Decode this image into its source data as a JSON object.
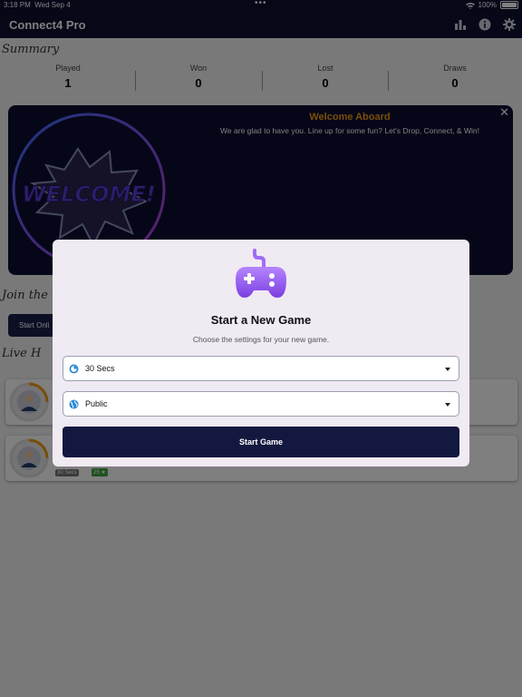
{
  "status_bar": {
    "time": "3:18 PM",
    "date": "Wed Sep 4",
    "dots": "•••",
    "battery": "100%"
  },
  "navbar": {
    "title": "Connect4 Pro",
    "icons": [
      "bar-chart-icon",
      "info-icon",
      "gear-icon"
    ]
  },
  "summary": {
    "title": "Summary",
    "stats": [
      {
        "label": "Played",
        "value": "1"
      },
      {
        "label": "Won",
        "value": "0"
      },
      {
        "label": "Lost",
        "value": "0"
      },
      {
        "label": "Draws",
        "value": "0"
      }
    ]
  },
  "welcome_banner": {
    "title": "Welcome Aboard",
    "subtitle": "We are glad to have you. Line up for some fun? Let's Drop, Connect, & Win!",
    "graphic_text": "WELCOME!",
    "close": "✕"
  },
  "join": {
    "title": "Join the T",
    "button": "Start Onli"
  },
  "live": {
    "title": "Live H",
    "games": [
      {
        "time_tag": "",
        "points_tag": ""
      },
      {
        "time_tag": "30 Secs",
        "points_tag": "25 ★"
      }
    ]
  },
  "modal": {
    "title": "Start a New Game",
    "subtitle": "Choose the settings for your new game.",
    "time_select": {
      "value": "30 Secs",
      "icon": "timer-icon"
    },
    "visibility_select": {
      "value": "Public",
      "icon": "globe-icon"
    },
    "start_button": "Start Game"
  },
  "colors": {
    "navy": "#0d1030",
    "accent_orange": "#f39c12",
    "modal_bg": "#f0eaf3",
    "gamepad": "#9a5cf0"
  }
}
